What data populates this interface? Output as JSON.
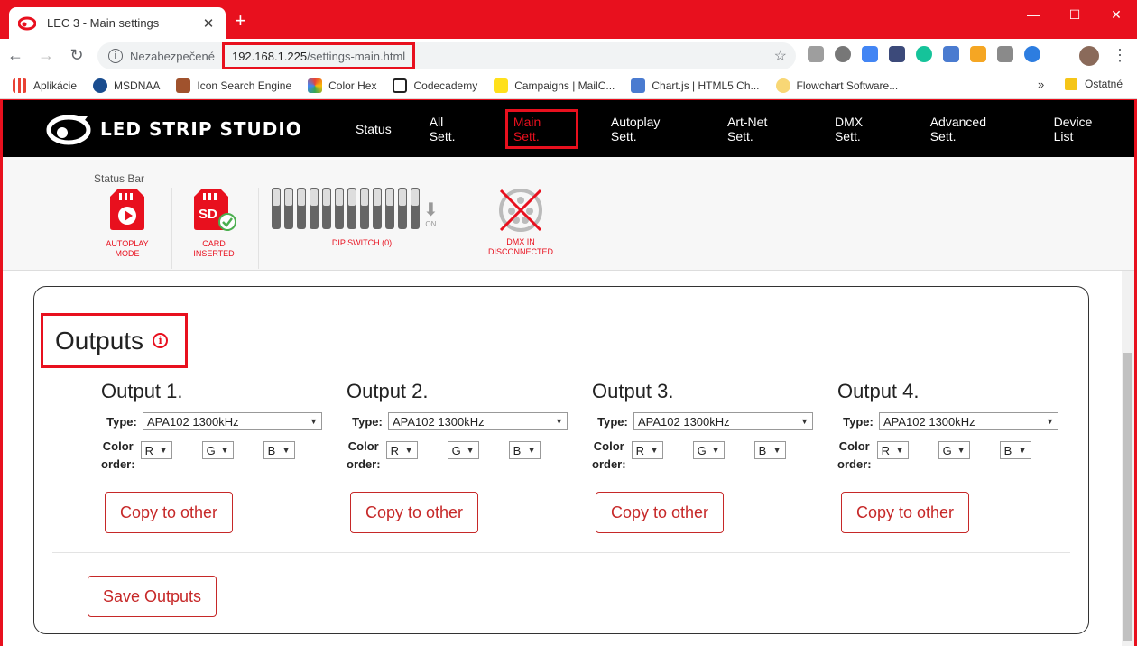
{
  "browser": {
    "tab_title": "LEC 3 - Main settings",
    "address_prefix": "Nezabezpečené",
    "url_host": "192.168.1.225",
    "url_path": "/settings-main.html",
    "bookmarks": [
      "Aplikácie",
      "MSDNAA",
      "Icon Search Engine",
      "Color Hex",
      "Codecademy",
      "Campaigns | MailC...",
      "Chart.js | HTML5 Ch...",
      "Flowchart Software..."
    ],
    "bookmarks_more": "»",
    "bookmarks_other": "Ostatné",
    "accent": "#e8101e"
  },
  "header": {
    "logo_text": "LED STRIP STUDIO",
    "nav": [
      "Status",
      "All Sett.",
      "Main Sett.",
      "Autoplay Sett.",
      "Art-Net Sett.",
      "DMX Sett.",
      "Advanced Sett.",
      "Device List"
    ],
    "active_nav": "Main Sett."
  },
  "status_bar": {
    "label": "Status Bar",
    "autoplay": "AUTOPLAY MODE",
    "autoplay_l1": "AUTOPLAY",
    "autoplay_l2": "MODE",
    "card_l1": "CARD",
    "card_l2": "INSERTED",
    "sd_text": "SD",
    "dip_switch": "DIP SWITCH (0)",
    "dip_on": "ON",
    "dmx_l1": "DMX IN",
    "dmx_l2": "DISCONNECTED"
  },
  "outputs": {
    "title": "Outputs",
    "info_glyph": "i",
    "type_label": "Type:",
    "color_label_1": "Color",
    "color_label_2": "order:",
    "copy_label": "Copy to other",
    "save_label": "Save Outputs",
    "items": [
      {
        "title": "Output 1.",
        "type": "APA102 1300kHz",
        "r": "R",
        "g": "G",
        "b": "B"
      },
      {
        "title": "Output 2.",
        "type": "APA102 1300kHz",
        "r": "R",
        "g": "G",
        "b": "B"
      },
      {
        "title": "Output 3.",
        "type": "APA102 1300kHz",
        "r": "R",
        "g": "G",
        "b": "B"
      },
      {
        "title": "Output 4.",
        "type": "APA102 1300kHz",
        "r": "R",
        "g": "G",
        "b": "B"
      }
    ]
  }
}
